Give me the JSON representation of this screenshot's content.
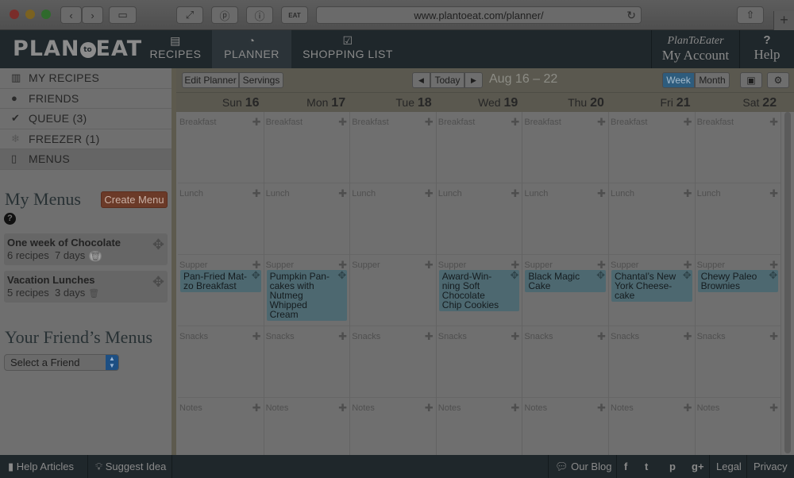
{
  "browser": {
    "url": "www.plantoeat.com/planner/",
    "newtab": "+"
  },
  "header": {
    "logo": {
      "left": "PLAN",
      "mid": "to",
      "right": "EAT"
    },
    "nav": [
      {
        "label": "RECIPES",
        "icon": "recipes-icon"
      },
      {
        "label": "PLANNER",
        "icon": "clock-icon"
      },
      {
        "label": "SHOPPING LIST",
        "icon": "checklist-icon"
      }
    ],
    "user": "PlanToEater",
    "account": "My Account",
    "help_icon": "?",
    "help": "Help"
  },
  "sidebar": {
    "nav": [
      {
        "label": "MY RECIPES",
        "icon": "books-icon"
      },
      {
        "label": "FRIENDS",
        "icon": "person-icon"
      },
      {
        "label": "QUEUE (3)",
        "icon": "check-icon"
      },
      {
        "label": "FREEZER (1)",
        "icon": "snowflake-icon"
      },
      {
        "label": "MENUS",
        "icon": "open-book-icon"
      }
    ],
    "mymenus_title": "My Menus",
    "create_menu": "Create Menu",
    "help_icon": "?",
    "menus": [
      {
        "title": "One week of Chocolate",
        "recipes": "6 recipes",
        "days": "7 days"
      },
      {
        "title": "Vacation Lunches",
        "recipes": "5 recipes",
        "days": "3 days"
      }
    ],
    "friends_title": "Your Friend’s Menus",
    "friend_select": "Select a Friend"
  },
  "planner": {
    "edit_planner": "Edit Planner",
    "servings": "Servings",
    "prev": "◀",
    "today": "Today",
    "next": "▶",
    "range": "Aug 16 – 22",
    "week": "Week",
    "month": "Month",
    "days": [
      {
        "name": "Sun",
        "num": "16"
      },
      {
        "name": "Mon",
        "num": "17"
      },
      {
        "name": "Tue",
        "num": "18"
      },
      {
        "name": "Wed",
        "num": "19"
      },
      {
        "name": "Thu",
        "num": "20"
      },
      {
        "name": "Fri",
        "num": "21"
      },
      {
        "name": "Sat",
        "num": "22"
      }
    ],
    "meals": [
      "Breakfast",
      "Lunch",
      "Supper",
      "Snacks",
      "Notes"
    ],
    "supper_recipes": [
      "Pan-Fried Mat-\nzo Breakfast",
      "Pumpkin Pan-\ncakes with\nNutmeg\nWhipped\nCream",
      "",
      "Award-Win-\nning Soft\nChocolate\nChip Cookies",
      "Black Magic\nCake",
      "Chantal’s New\nYork Cheese-\ncake",
      "Chewy Paleo\nBrownies"
    ]
  },
  "footer": {
    "help_articles": "Help Articles",
    "suggest_idea": "Suggest Idea",
    "our_blog": "Our Blog",
    "social": [
      "f",
      "t",
      "p",
      "g+"
    ],
    "legal": "Legal",
    "privacy": "Privacy"
  }
}
